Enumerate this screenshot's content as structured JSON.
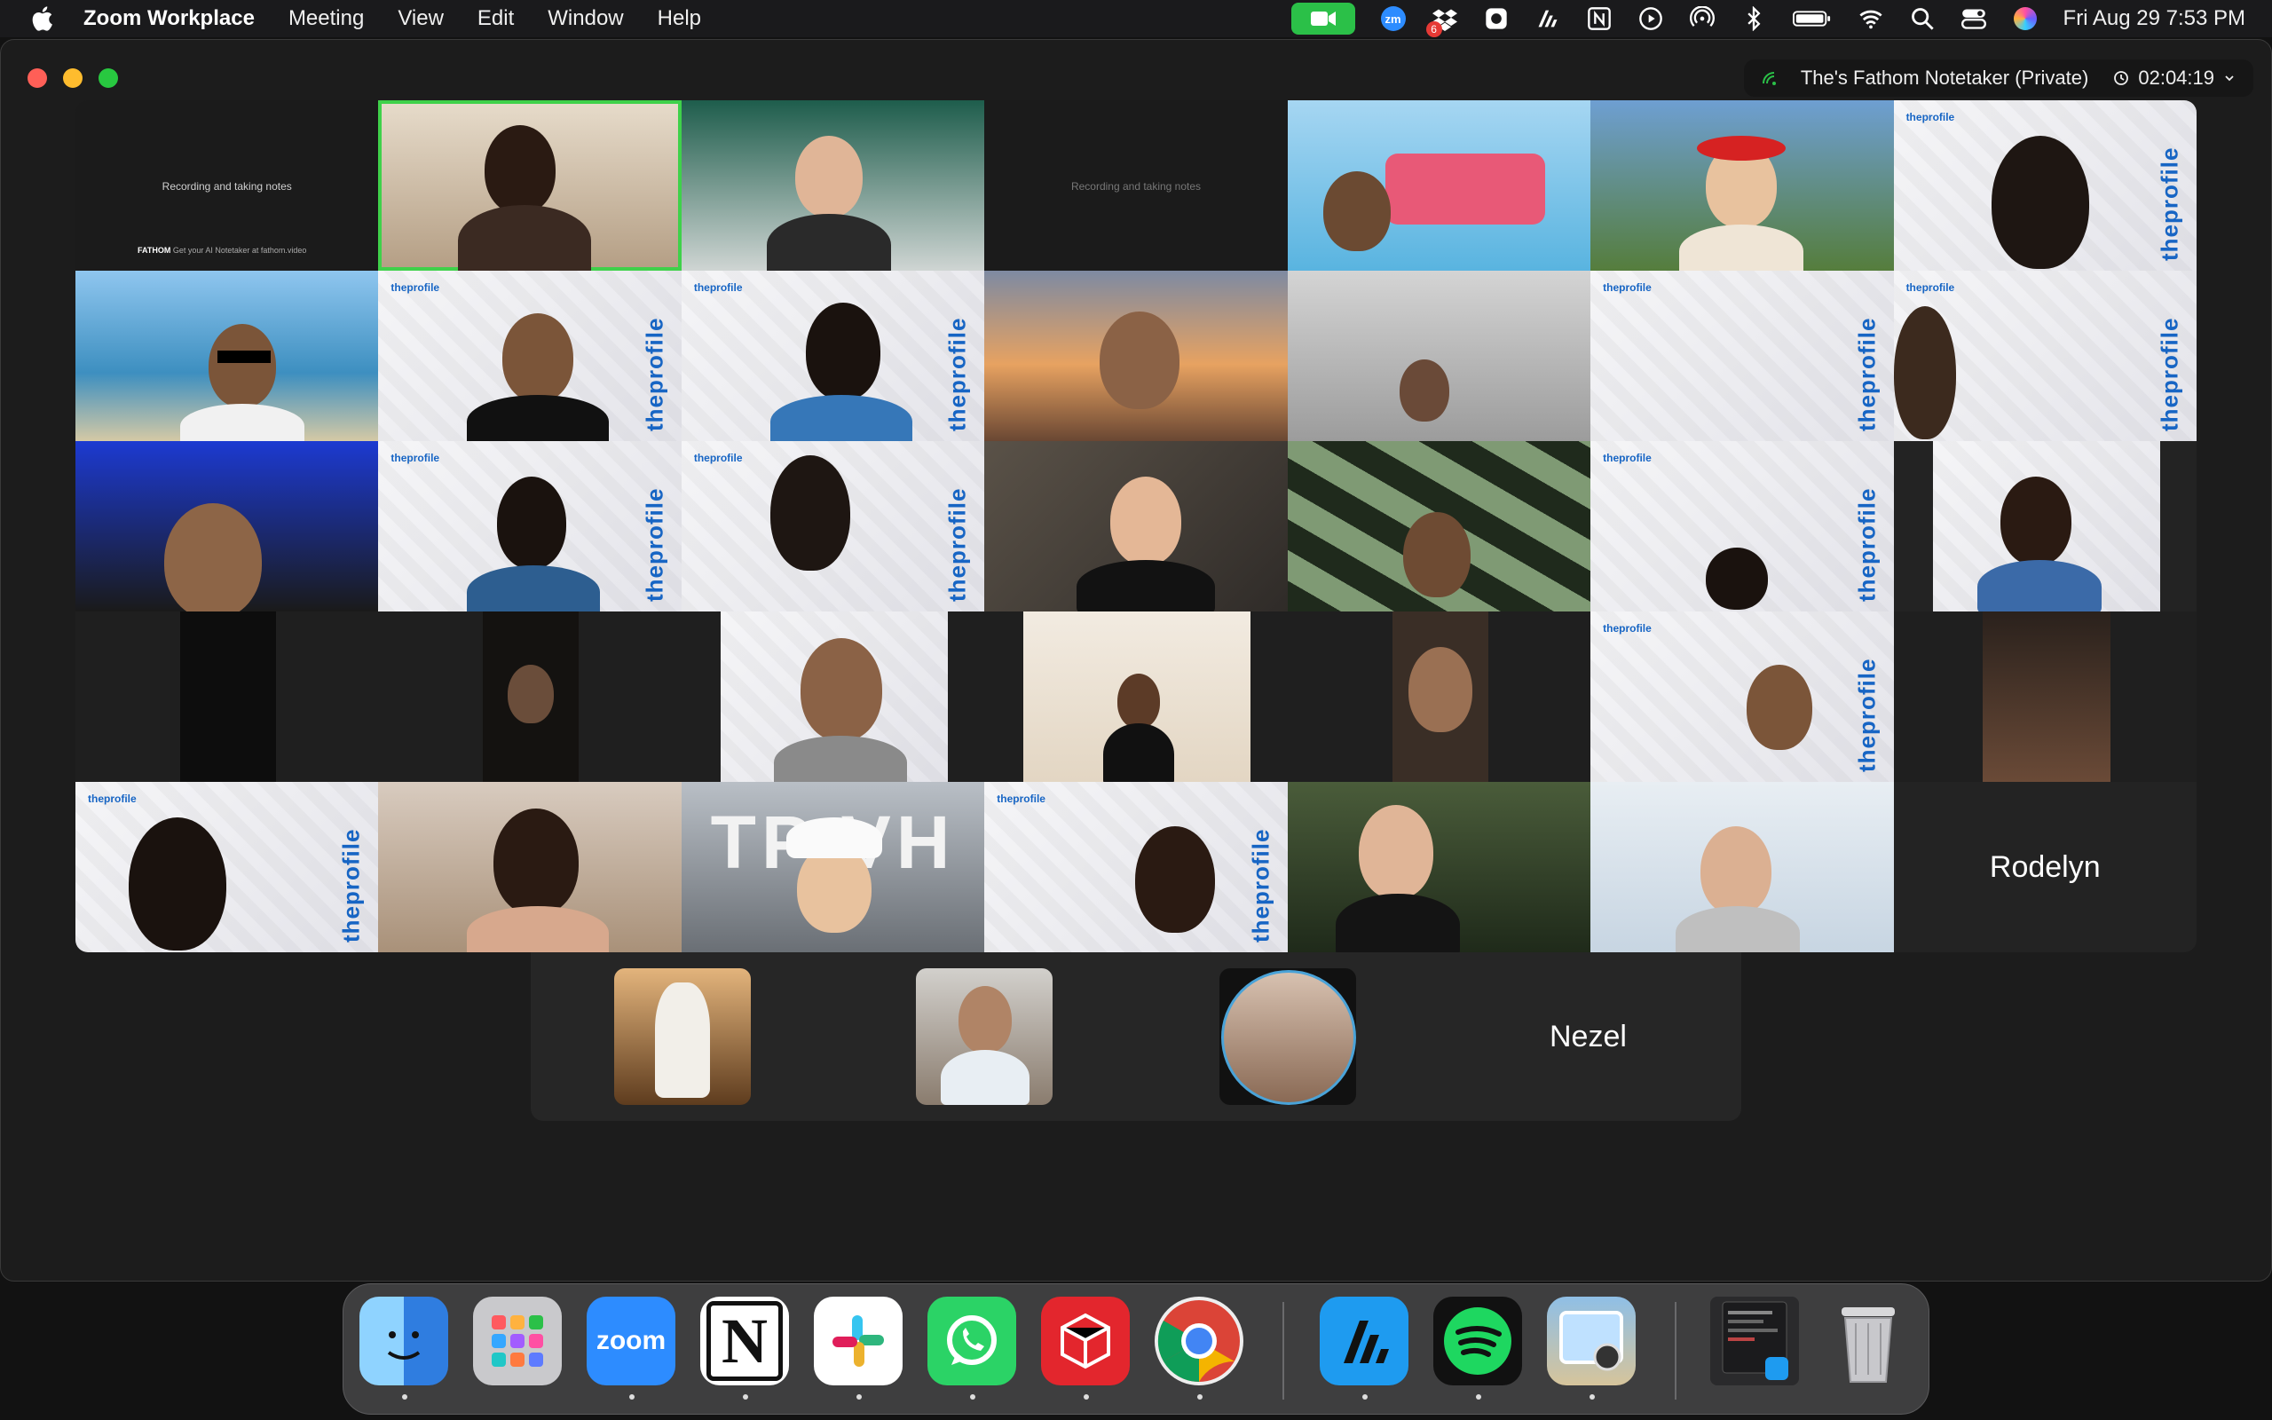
{
  "menubar": {
    "app_name": "Zoom Workplace",
    "menus": [
      "Meeting",
      "View",
      "Edit",
      "Window",
      "Help"
    ],
    "clock": "Fri Aug 29  7:53 PM",
    "badge_count": "6",
    "zoom_badge": "zm"
  },
  "window": {
    "notetaker": "The's Fathom Notetaker (Private)",
    "timer": "02:04:19"
  },
  "gallery": {
    "fathom_caption": "Recording and taking notes",
    "fathom_foot_brand": "FATHOM",
    "fathom_foot_text": "Get your AI Notetaker at fathom.video",
    "profile_logo": "theprofile",
    "tile_names": [
      "Rodelyn"
    ],
    "overlay_text": "TP VH"
  },
  "filmstrip": {
    "name": "Nezel"
  },
  "dock": {
    "zoom_label": "zoom",
    "notion_label": "N"
  },
  "colors": {
    "active_speaker": "#3fd14a",
    "camera_pill": "#2bc048",
    "profile_brand": "#1765c4"
  }
}
